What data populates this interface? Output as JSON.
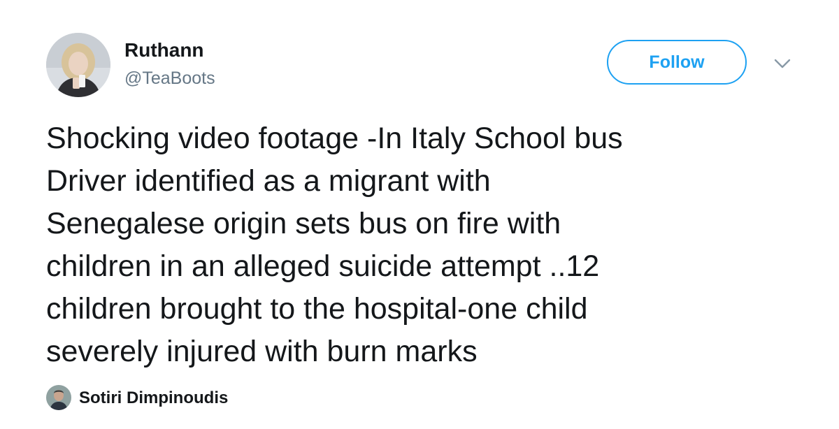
{
  "author": {
    "display_name": "Ruthann",
    "handle": "@TeaBoots",
    "avatar_icon": "profile-photo-woman-blonde"
  },
  "actions": {
    "follow_label": "Follow",
    "more_icon": "chevron-down-icon"
  },
  "tweet": {
    "text": "Shocking video footage -In Italy School bus\nDriver identified as a migrant with\nSenegalese origin sets bus on fire with\nchildren in an alleged suicide attempt ..12\nchildren brought to the hospital-one child\nseverely injured with burn marks"
  },
  "footer": {
    "name": "Sotiri Dimpinoudis",
    "avatar_icon": "profile-photo-man"
  },
  "colors": {
    "accent": "#1da1f2",
    "text_primary": "#14171a",
    "text_secondary": "#657786"
  }
}
